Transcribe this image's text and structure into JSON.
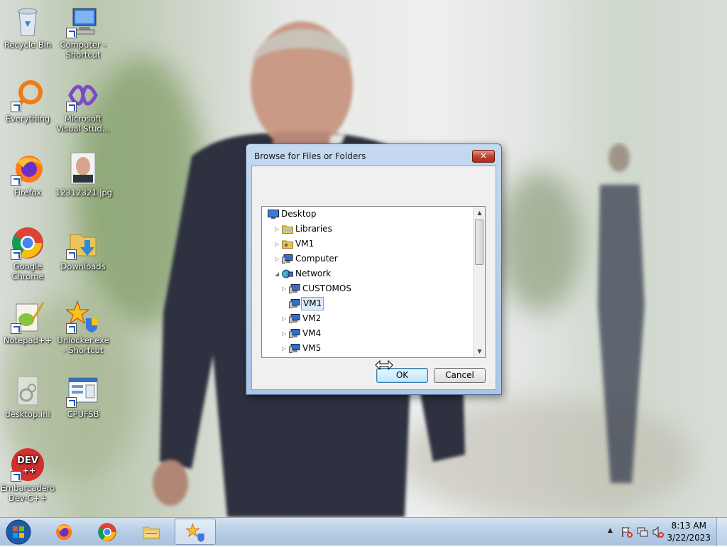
{
  "desktop": {
    "icons": [
      {
        "label": "Recycle Bin",
        "icon": "recycle-bin-icon"
      },
      {
        "label": "Computer - Shortcut",
        "icon": "computer-icon"
      },
      {
        "label": "Everything",
        "icon": "everything-icon"
      },
      {
        "label": "Microsoft Visual Stud...",
        "icon": "visual-studio-icon"
      },
      {
        "label": "Firefox",
        "icon": "firefox-icon"
      },
      {
        "label": "12312321.jpg",
        "icon": "image-file-icon"
      },
      {
        "label": "Google Chrome",
        "icon": "chrome-icon"
      },
      {
        "label": "Downloads",
        "icon": "downloads-folder-icon"
      },
      {
        "label": "Notepad++",
        "icon": "notepadpp-icon"
      },
      {
        "label": "Unlocker.exe - Shortcut",
        "icon": "unlocker-icon"
      },
      {
        "label": "desktop.ini",
        "icon": "ini-file-icon"
      },
      {
        "label": "CPUFSB",
        "icon": "cpufsb-icon"
      },
      {
        "label": "Embarcadero Dev-C++",
        "icon": "devcpp-icon"
      }
    ]
  },
  "dialog": {
    "title": "Browse for Files or Folders",
    "close_label": "✕",
    "tree": [
      {
        "label": "Desktop",
        "level": 0,
        "expander": "",
        "icon": "desktop-icon"
      },
      {
        "label": "Libraries",
        "level": 1,
        "expander": "▷",
        "icon": "libraries-icon"
      },
      {
        "label": "VM1",
        "level": 1,
        "expander": "▷",
        "icon": "user-folder-icon"
      },
      {
        "label": "Computer",
        "level": 1,
        "expander": "▷",
        "icon": "computer-icon"
      },
      {
        "label": "Network",
        "level": 1,
        "expander": "◢",
        "icon": "network-icon"
      },
      {
        "label": "CUSTOMOS",
        "level": 2,
        "expander": "▷",
        "icon": "network-computer-icon"
      },
      {
        "label": "VM1",
        "level": 2,
        "expander": "",
        "icon": "network-computer-icon",
        "selected": true
      },
      {
        "label": "VM2",
        "level": 2,
        "expander": "▷",
        "icon": "network-computer-icon"
      },
      {
        "label": "VM4",
        "level": 2,
        "expander": "▷",
        "icon": "network-computer-icon"
      },
      {
        "label": "VM5",
        "level": 2,
        "expander": "▷",
        "icon": "network-computer-icon"
      }
    ],
    "ok_label": "OK",
    "cancel_label": "Cancel"
  },
  "taskbar": {
    "apps": [
      {
        "name": "firefox",
        "icon": "firefox-icon",
        "active": false
      },
      {
        "name": "chrome",
        "icon": "chrome-icon",
        "active": false
      },
      {
        "name": "explorer",
        "icon": "folder-icon",
        "active": false
      },
      {
        "name": "unlocker",
        "icon": "unlocker-icon",
        "active": true
      }
    ],
    "clock_time": "8:13 AM",
    "clock_date": "3/22/2023"
  }
}
